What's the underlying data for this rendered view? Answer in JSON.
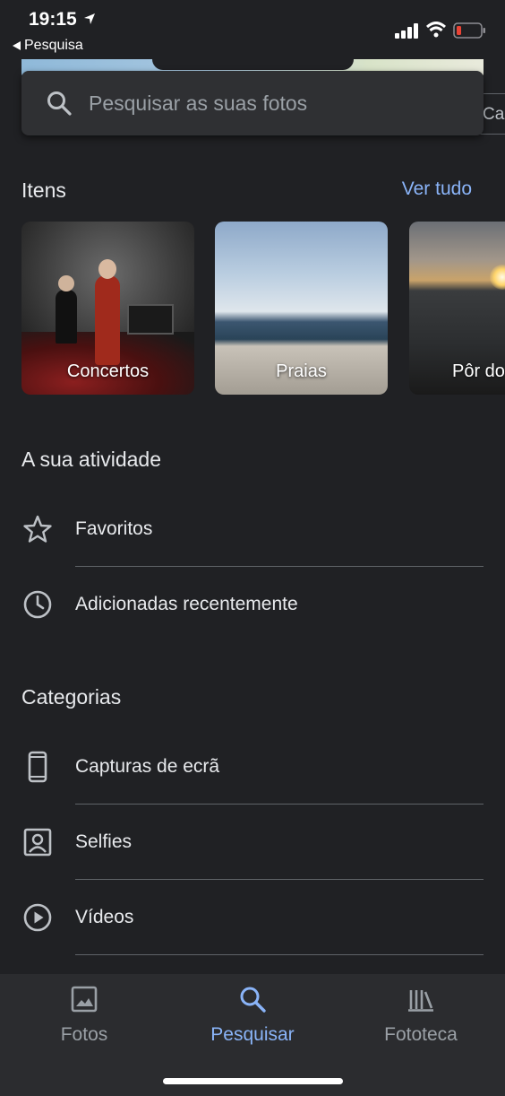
{
  "status_bar": {
    "time": "19:15",
    "back_label": "Pesquisa"
  },
  "search": {
    "placeholder": "Pesquisar as suas fotos",
    "side_chip_text": "Ca"
  },
  "items_section": {
    "title": "Itens",
    "see_all": "Ver tudo",
    "cards": [
      {
        "label": "Concertos"
      },
      {
        "label": "Praias"
      },
      {
        "label": "Pôr do"
      }
    ]
  },
  "activity_section": {
    "title": "A sua atividade",
    "rows": [
      {
        "label": "Favoritos",
        "icon": "star-icon"
      },
      {
        "label": "Adicionadas recentemente",
        "icon": "clock-icon"
      }
    ]
  },
  "categories_section": {
    "title": "Categorias",
    "rows": [
      {
        "label": "Capturas de ecrã",
        "icon": "phone-icon"
      },
      {
        "label": "Selfies",
        "icon": "portrait-icon"
      },
      {
        "label": "Vídeos",
        "icon": "play-icon"
      }
    ]
  },
  "bottom_nav": {
    "items": [
      {
        "label": "Fotos",
        "icon": "image-icon",
        "active": false
      },
      {
        "label": "Pesquisar",
        "icon": "search-icon",
        "active": true
      },
      {
        "label": "Fototeca",
        "icon": "library-icon",
        "active": false
      }
    ]
  },
  "colors": {
    "background": "#202124",
    "accent": "#8ab4f8",
    "text": "#e8eaed",
    "muted": "#9aa0a6",
    "battery_low": "#ea4335"
  }
}
